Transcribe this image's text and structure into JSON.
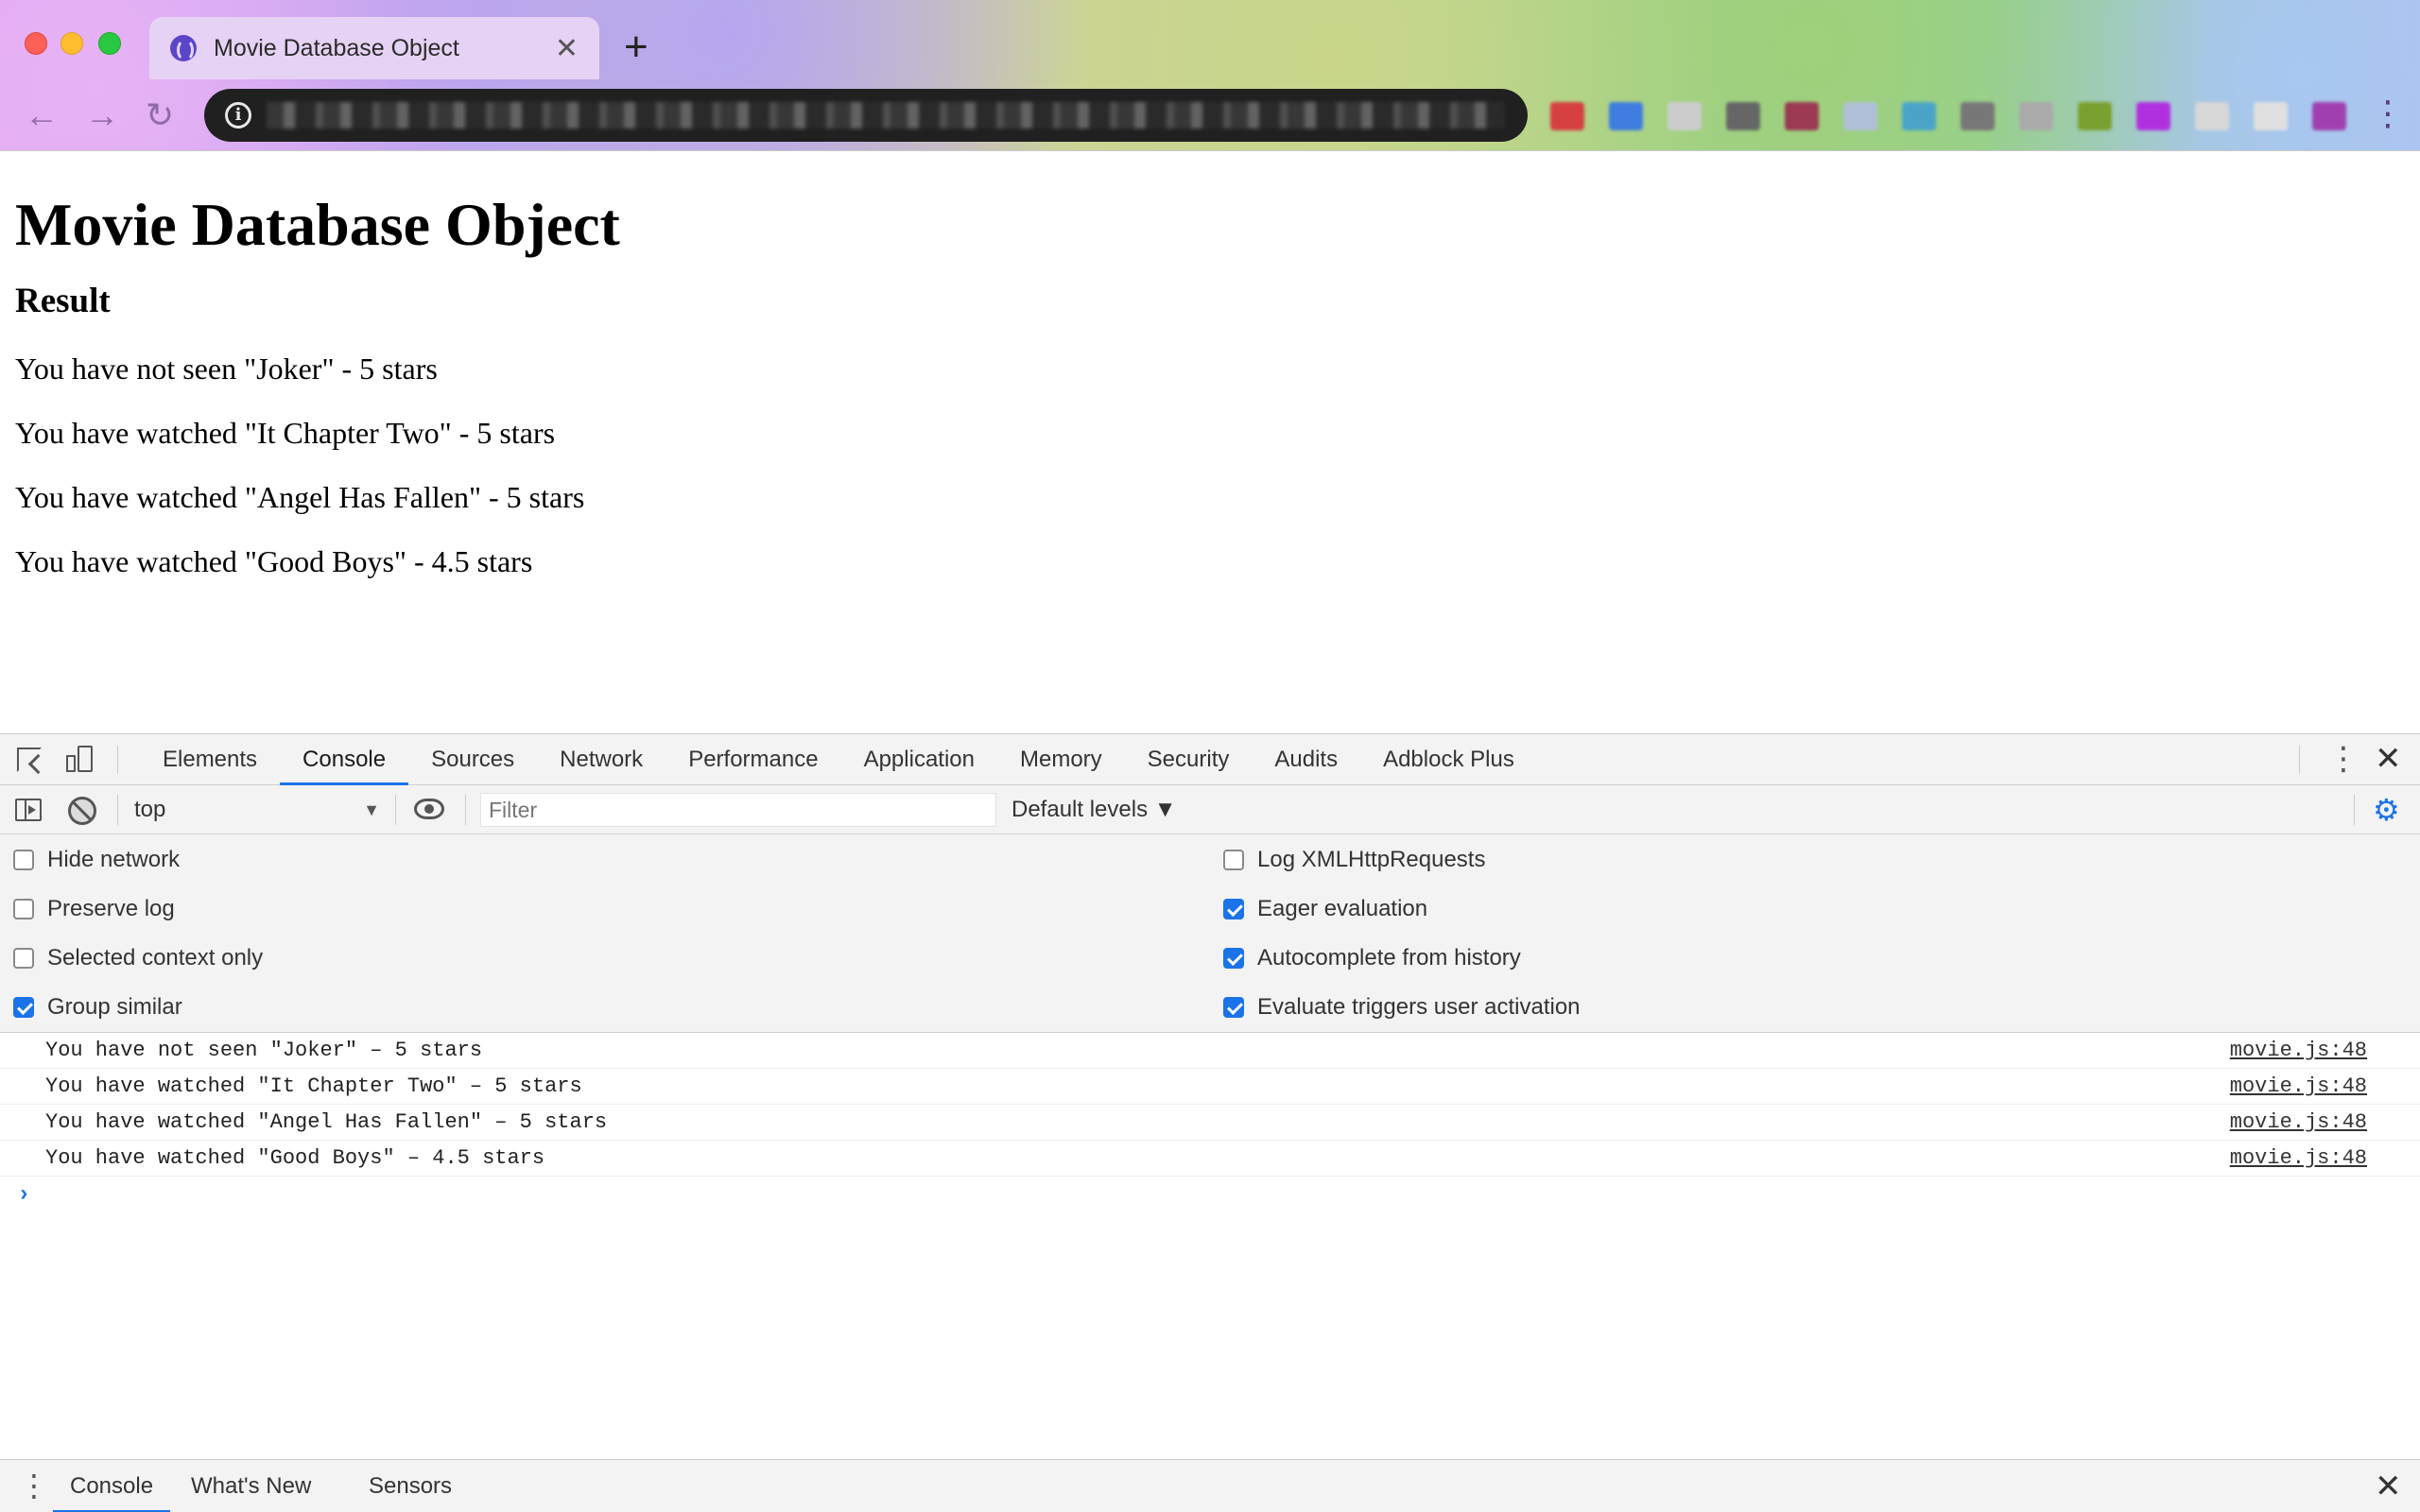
{
  "browser": {
    "tab_title": "Movie Database Object",
    "tab_close": "✕",
    "new_tab": "+",
    "nav": {
      "back": "←",
      "forward": "→",
      "reload": "↻"
    },
    "info_icon": "i",
    "menu": "⋮",
    "extension_colors": [
      "#d64040",
      "#3f7de0",
      "#cccccc",
      "#666666",
      "#9b3a52",
      "#b0c0d8",
      "#4aa4c8",
      "#777777",
      "#aaaaaa",
      "#7aa030",
      "#b030e0",
      "#d8d8d8",
      "#e0e0e0",
      "#a040b0"
    ]
  },
  "page": {
    "heading": "Movie Database Object",
    "subheading": "Result",
    "results": [
      "You have not seen \"Joker\" - 5 stars",
      "You have watched \"It Chapter Two\" - 5 stars",
      "You have watched \"Angel Has Fallen\" - 5 stars",
      "You have watched \"Good Boys\" - 4.5 stars"
    ]
  },
  "devtools": {
    "tabs": [
      "Elements",
      "Console",
      "Sources",
      "Network",
      "Performance",
      "Application",
      "Memory",
      "Security",
      "Audits",
      "Adblock Plus"
    ],
    "active_tab": "Console",
    "kebab": "⋮",
    "close": "✕",
    "toolbar": {
      "context": "top",
      "context_arrow": "▼",
      "filter_placeholder": "Filter",
      "levels": "Default levels ▼",
      "gear": "⚙"
    },
    "settings_left": [
      {
        "label": "Hide network",
        "checked": false
      },
      {
        "label": "Preserve log",
        "checked": false
      },
      {
        "label": "Selected context only",
        "checked": false
      },
      {
        "label": "Group similar",
        "checked": true
      }
    ],
    "settings_right": [
      {
        "label": "Log XMLHttpRequests",
        "checked": false
      },
      {
        "label": "Eager evaluation",
        "checked": true
      },
      {
        "label": "Autocomplete from history",
        "checked": true
      },
      {
        "label": "Evaluate triggers user activation",
        "checked": true
      }
    ],
    "console_logs": [
      {
        "message": "You have not seen \"Joker\" – 5 stars",
        "source": "movie.js:48"
      },
      {
        "message": "You have watched \"It Chapter Two\" – 5 stars",
        "source": "movie.js:48"
      },
      {
        "message": "You have watched \"Angel Has Fallen\" – 5 stars",
        "source": "movie.js:48"
      },
      {
        "message": "You have watched \"Good Boys\" – 4.5 stars",
        "source": "movie.js:48"
      }
    ],
    "prompt": "›",
    "drawer": {
      "menu": "⋮",
      "tabs": [
        "Console",
        "What's New",
        "Sensors"
      ],
      "active": "Console",
      "close": "✕"
    }
  }
}
